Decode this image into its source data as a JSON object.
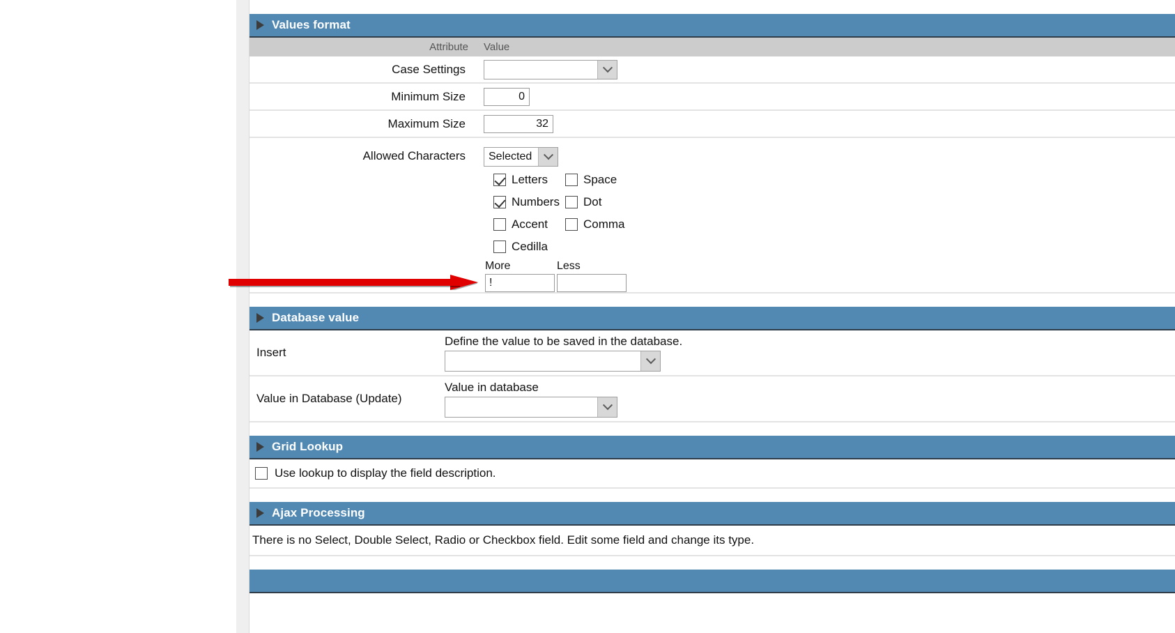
{
  "sections": {
    "values_format": {
      "title": "Values format",
      "columns": {
        "attribute": "Attribute",
        "value": "Value"
      },
      "rows": {
        "case_settings": {
          "label": "Case Settings",
          "value": ""
        },
        "minimum_size": {
          "label": "Minimum Size",
          "value": "0"
        },
        "maximum_size": {
          "label": "Maximum Size",
          "value": "32"
        },
        "allowed_characters": {
          "label": "Allowed Characters",
          "mode": "Selected",
          "checkboxes": [
            {
              "label": "Letters",
              "checked": true
            },
            {
              "label": "Space",
              "checked": false
            },
            {
              "label": "Numbers",
              "checked": true
            },
            {
              "label": "Dot",
              "checked": false
            },
            {
              "label": "Accent",
              "checked": false
            },
            {
              "label": "Comma",
              "checked": false
            },
            {
              "label": "Cedilla",
              "checked": false
            }
          ],
          "more_label": "More",
          "more_value": "!",
          "less_label": "Less",
          "less_value": ""
        }
      }
    },
    "database_value": {
      "title": "Database value",
      "insert": {
        "label": "Insert",
        "hint": "Define the value to be saved in the database.",
        "value": ""
      },
      "update": {
        "label": "Value in Database (Update)",
        "hint": "Value in database",
        "value": ""
      }
    },
    "grid_lookup": {
      "title": "Grid Lookup",
      "checkbox_label": "Use lookup to display the field description.",
      "checked": false
    },
    "ajax_processing": {
      "title": "Ajax Processing",
      "note": "There is no Select, Double Select, Radio or Checkbox field. Edit some field and change its type."
    }
  },
  "annotation": {
    "arrow_color": "#e00000",
    "target": "more-input"
  },
  "colors": {
    "section_bar": "#5289b3",
    "column_header": "#cccccc",
    "row_divider": "#e3e3e3"
  }
}
